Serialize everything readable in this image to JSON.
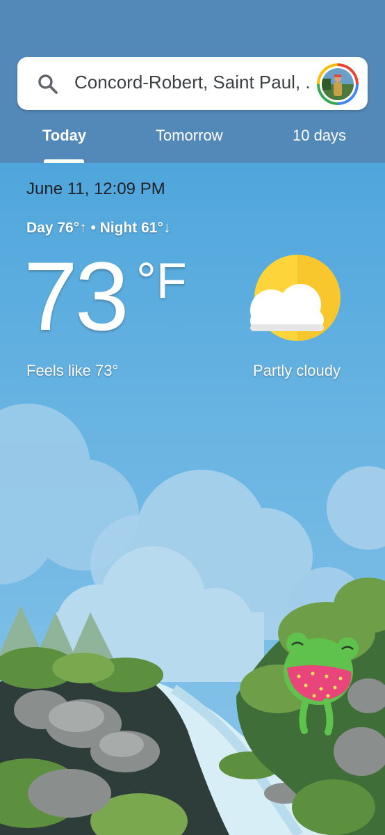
{
  "search": {
    "location": "Concord-Robert, Saint Paul, ..."
  },
  "tabs": [
    {
      "label": "Today",
      "active": true
    },
    {
      "label": "Tomorrow",
      "active": false
    },
    {
      "label": "10 days",
      "active": false
    }
  ],
  "current": {
    "datetime": "June 11, 12:09 PM",
    "day_night": "Day 76°↑ • Night 61°↓",
    "temperature": "73",
    "unit": "°F",
    "feels_like": "Feels like 73°",
    "condition": "Partly cloudy",
    "condition_icon": "partly-cloudy-icon"
  },
  "colors": {
    "header": "#5389b8",
    "sky": "#4fa6dc",
    "sun": "#fdd53a"
  }
}
